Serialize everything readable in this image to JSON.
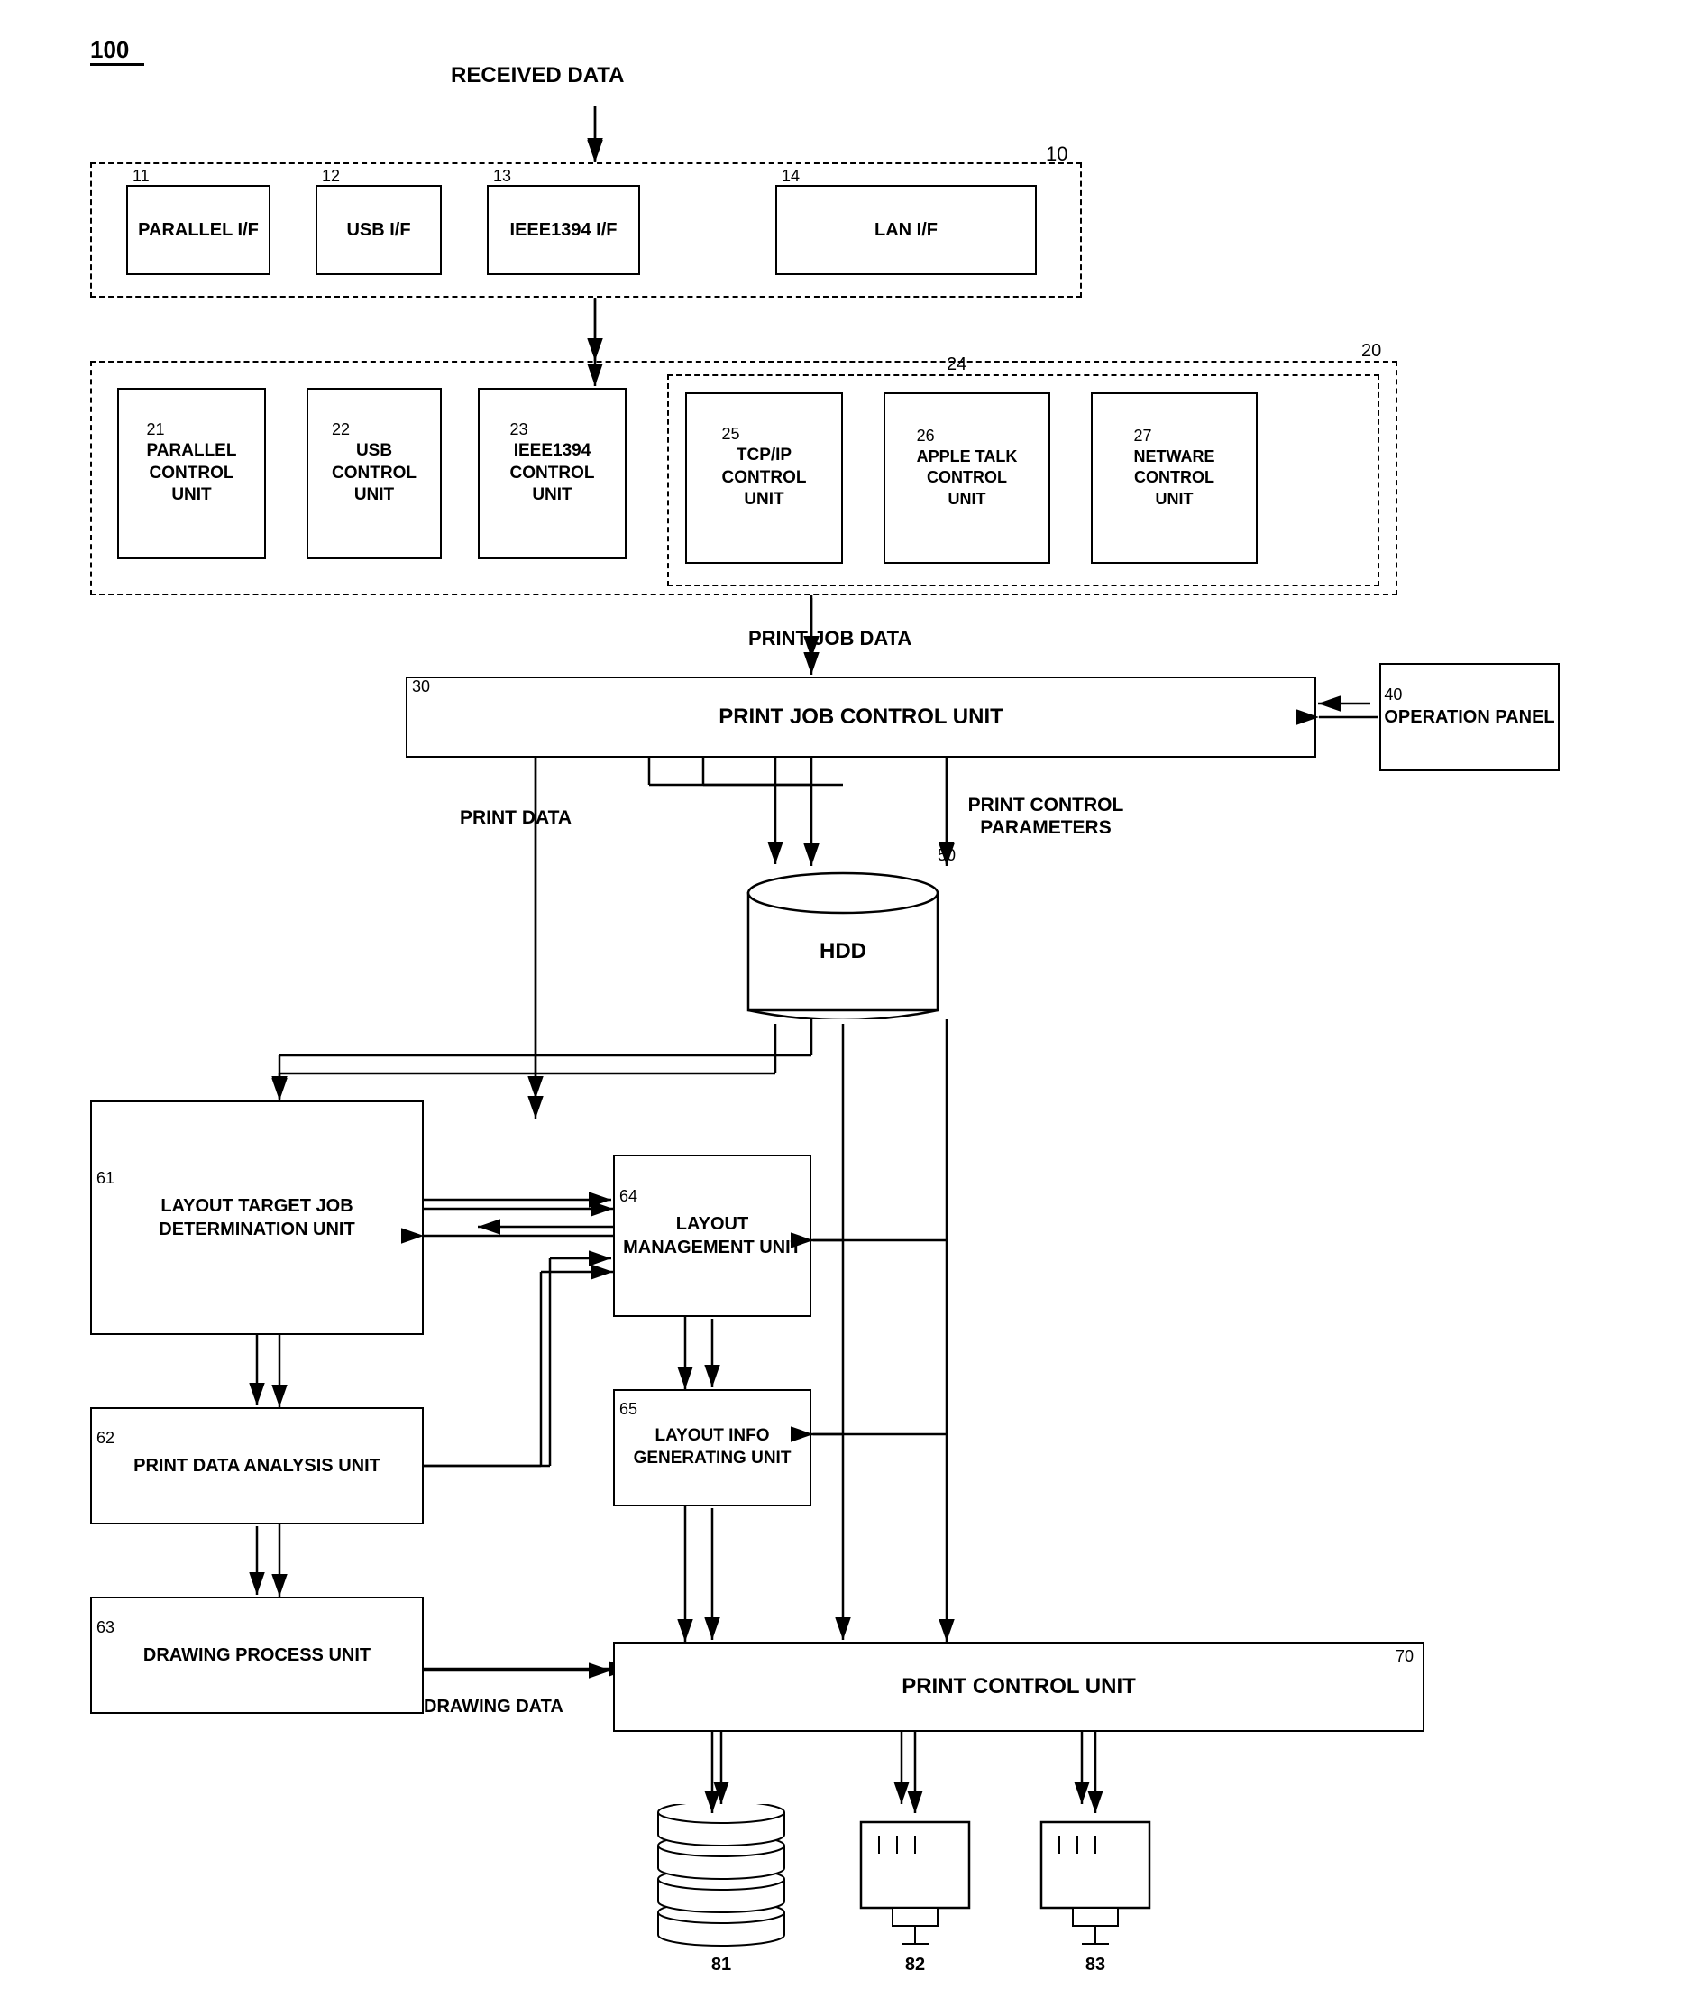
{
  "diagram": {
    "title": "100",
    "received_data_label": "RECEIVED DATA",
    "print_job_data_label": "PRINT JOB DATA",
    "print_data_label": "PRINT DATA",
    "print_control_params_label": "PRINT CONTROL PARAMETERS",
    "drawing_data_label": "DRAWING DATA",
    "group10": {
      "ref": "10",
      "boxes": [
        {
          "ref": "11",
          "label": "PARALLEL\nI/F"
        },
        {
          "ref": "12",
          "label": "USB\nI/F"
        },
        {
          "ref": "13",
          "label": "IEEE1394\nI/F"
        },
        {
          "ref": "14",
          "label": "LAN\nI/F"
        }
      ]
    },
    "group20": {
      "ref": "20",
      "boxes": [
        {
          "ref": "21",
          "label": "PARALLEL\nCONTROL\nUNIT"
        },
        {
          "ref": "22",
          "label": "USB\nCONTROL\nUNIT"
        },
        {
          "ref": "23",
          "label": "IEEE1394\nCONTROL\nUNIT"
        },
        {
          "ref": "24",
          "label": ""
        },
        {
          "ref": "25",
          "label": "TCP/IP\nCONTROL\nUNIT"
        },
        {
          "ref": "26",
          "label": "APPLE TALK\nCONTROL\nUNIT"
        },
        {
          "ref": "27",
          "label": "NETWARE\nCONTROL\nUNIT"
        }
      ]
    },
    "box30": {
      "ref": "30",
      "label": "PRINT JOB CONTROL UNIT"
    },
    "box40": {
      "ref": "40",
      "label": "OPERATION\nPANEL"
    },
    "box50": {
      "ref": "50",
      "label": "HDD"
    },
    "box61": {
      "ref": "61",
      "label": "LAYOUT\nTARGET JOB\nDETERMINATION\nUNIT"
    },
    "box62": {
      "ref": "62",
      "label": "PRINT DATA\nANALYSIS UNIT"
    },
    "box63": {
      "ref": "63",
      "label": "DRAWING\nPROCESS UNIT"
    },
    "box64": {
      "ref": "64",
      "label": "LAYOUT\nMANAGEMENT\nUNIT"
    },
    "box65": {
      "ref": "65",
      "label": "LAYOUT INFO\nGENERATING\nUNIT"
    },
    "box70": {
      "ref": "70",
      "label": "PRINT CONTROL UNIT"
    },
    "box81": {
      "ref": "81",
      "label": ""
    },
    "box82": {
      "ref": "82",
      "label": ""
    },
    "box83": {
      "ref": "83",
      "label": ""
    }
  }
}
